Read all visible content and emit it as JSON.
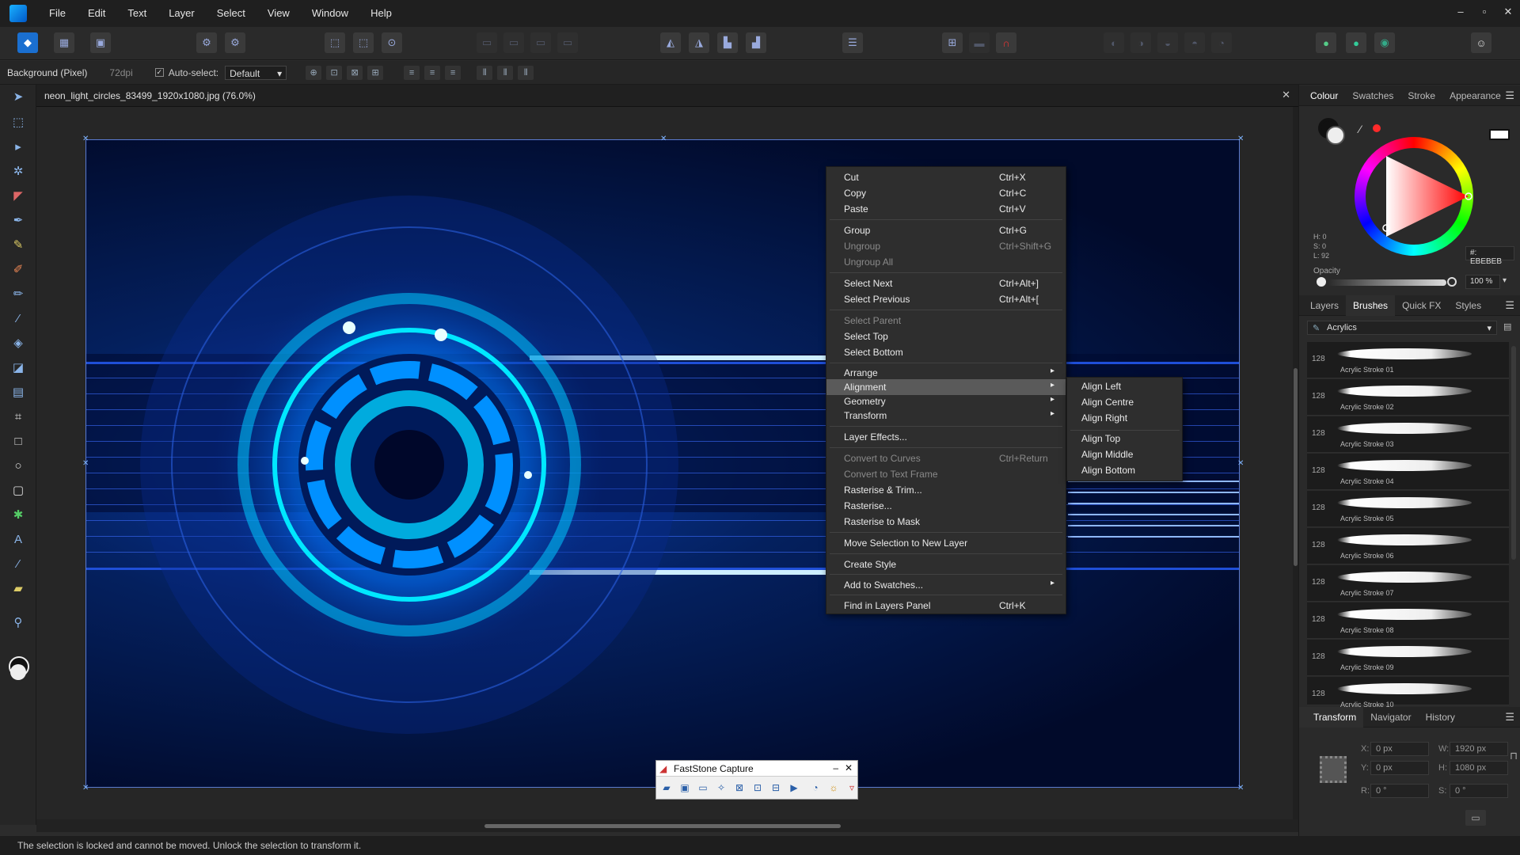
{
  "menubar": {
    "items": [
      "File",
      "Edit",
      "Text",
      "Layer",
      "Select",
      "View",
      "Window",
      "Help"
    ],
    "win_controls": [
      "–",
      "▫",
      "✕"
    ]
  },
  "context_toolbar": {
    "layer_label": "Background (Pixel)",
    "dpi": "72dpi",
    "autoselect_label": "Auto-select:",
    "autoselect_value": "Default",
    "check": "✓"
  },
  "document": {
    "tab_title": "neon_light_circles_83499_1920x1080.jpg (76.0%)",
    "close": "✕"
  },
  "status": {
    "text": "The selection is locked and cannot be moved. Unlock the selection to transform it."
  },
  "colour_panel": {
    "tabs": [
      "Colour",
      "Swatches",
      "Stroke",
      "Appearance"
    ],
    "hsl": [
      "H: 0",
      "S: 0",
      "L: 92"
    ],
    "hex": "#: EBEBEB",
    "opacity_label": "Opacity",
    "opacity_value": "100 %",
    "accent": "#ff2a2a"
  },
  "brushes_panel": {
    "tabs": [
      "Layers",
      "Brushes",
      "Quick FX",
      "Styles"
    ],
    "category": "Acrylics",
    "brushes": [
      {
        "size": "128",
        "name": "Acrylic Stroke 01"
      },
      {
        "size": "128",
        "name": "Acrylic Stroke 02"
      },
      {
        "size": "128",
        "name": "Acrylic Stroke 03"
      },
      {
        "size": "128",
        "name": "Acrylic Stroke 04"
      },
      {
        "size": "128",
        "name": "Acrylic Stroke 05"
      },
      {
        "size": "128",
        "name": "Acrylic Stroke 06"
      },
      {
        "size": "128",
        "name": "Acrylic Stroke 07"
      },
      {
        "size": "128",
        "name": "Acrylic Stroke 08"
      },
      {
        "size": "128",
        "name": "Acrylic Stroke 09"
      },
      {
        "size": "128",
        "name": "Acrylic Stroke 10"
      }
    ]
  },
  "transform_panel": {
    "tabs": [
      "Transform",
      "Navigator",
      "History"
    ],
    "x_label": "X:",
    "x": "0 px",
    "y_label": "Y:",
    "y": "0 px",
    "w_label": "W:",
    "w": "1920 px",
    "h_label": "H:",
    "h": "1080 px",
    "r_label": "R:",
    "r": "0 °",
    "s_label": "S:",
    "s": "0 °"
  },
  "context_menu": {
    "cut": {
      "label": "Cut",
      "shortcut": "Ctrl+X"
    },
    "copy": {
      "label": "Copy",
      "shortcut": "Ctrl+C"
    },
    "paste": {
      "label": "Paste",
      "shortcut": "Ctrl+V"
    },
    "group": {
      "label": "Group",
      "shortcut": "Ctrl+G"
    },
    "ungroup": {
      "label": "Ungroup",
      "shortcut": "Ctrl+Shift+G"
    },
    "ungroup_all": {
      "label": "Ungroup All"
    },
    "select_next": {
      "label": "Select Next",
      "shortcut": "Ctrl+Alt+]"
    },
    "select_previous": {
      "label": "Select Previous",
      "shortcut": "Ctrl+Alt+["
    },
    "select_parent": {
      "label": "Select Parent"
    },
    "select_top": {
      "label": "Select Top"
    },
    "select_bottom": {
      "label": "Select Bottom"
    },
    "arrange": {
      "label": "Arrange"
    },
    "alignment": {
      "label": "Alignment"
    },
    "geometry": {
      "label": "Geometry"
    },
    "transform": {
      "label": "Transform"
    },
    "layer_effects": {
      "label": "Layer Effects..."
    },
    "convert_curves": {
      "label": "Convert to Curves",
      "shortcut": "Ctrl+Return"
    },
    "convert_text": {
      "label": "Convert to Text Frame"
    },
    "rasterise_trim": {
      "label": "Rasterise & Trim..."
    },
    "rasterise": {
      "label": "Rasterise..."
    },
    "rasterise_mask": {
      "label": "Rasterise to Mask"
    },
    "move_selection": {
      "label": "Move Selection to New Layer"
    },
    "create_style": {
      "label": "Create Style"
    },
    "add_swatches": {
      "label": "Add to Swatches..."
    },
    "find_layers": {
      "label": "Find in Layers Panel",
      "shortcut": "Ctrl+K"
    },
    "arrow": "▸"
  },
  "alignment_submenu": {
    "items": [
      "Align Left",
      "Align Centre",
      "Align Right",
      "Align Top",
      "Align Middle",
      "Align Bottom"
    ]
  },
  "faststone": {
    "title": "FastStone Capture",
    "min": "–",
    "close": "✕"
  }
}
